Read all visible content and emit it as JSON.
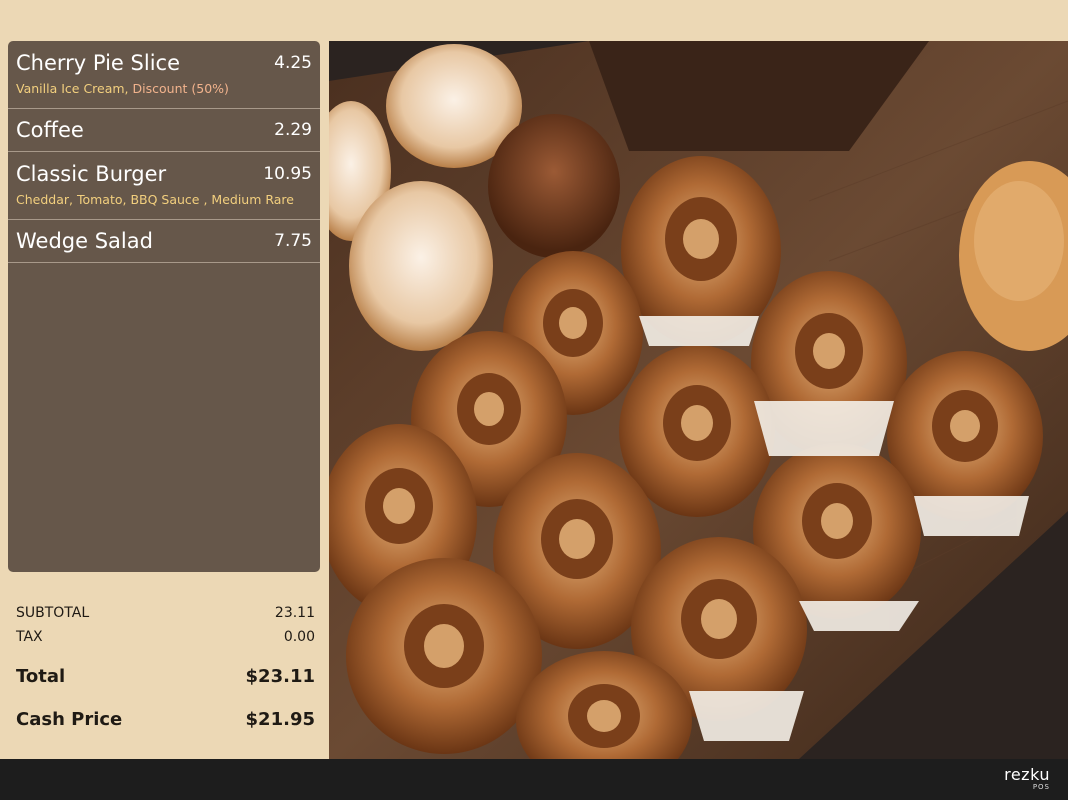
{
  "order": {
    "items": [
      {
        "name": "Cherry Pie Slice",
        "price": "4.25",
        "modifiers": "Vanilla Ice Cream, ",
        "discount": "Discount (50%)"
      },
      {
        "name": "Coffee",
        "price": "2.29"
      },
      {
        "name": "Classic Burger",
        "price": "10.95",
        "modifiers": "Cheddar, Tomato, BBQ Sauce , Medium Rare"
      },
      {
        "name": "Wedge Salad",
        "price": "7.75"
      }
    ]
  },
  "totals": {
    "subtotal_label": "SUBTOTAL",
    "subtotal": "23.11",
    "tax_label": "TAX",
    "tax": "0.00",
    "total_label": "Total",
    "total": "$23.11",
    "cash_label": "Cash Price",
    "cash": "$21.95"
  },
  "brand": {
    "name": "rezku",
    "sub": "POS"
  },
  "colors": {
    "panel": "#66574a",
    "background": "#ecd8b5",
    "modifier": "#f2cf7e",
    "footer": "#1d1d1d"
  },
  "photo": {
    "subject": "pastry-photo"
  }
}
